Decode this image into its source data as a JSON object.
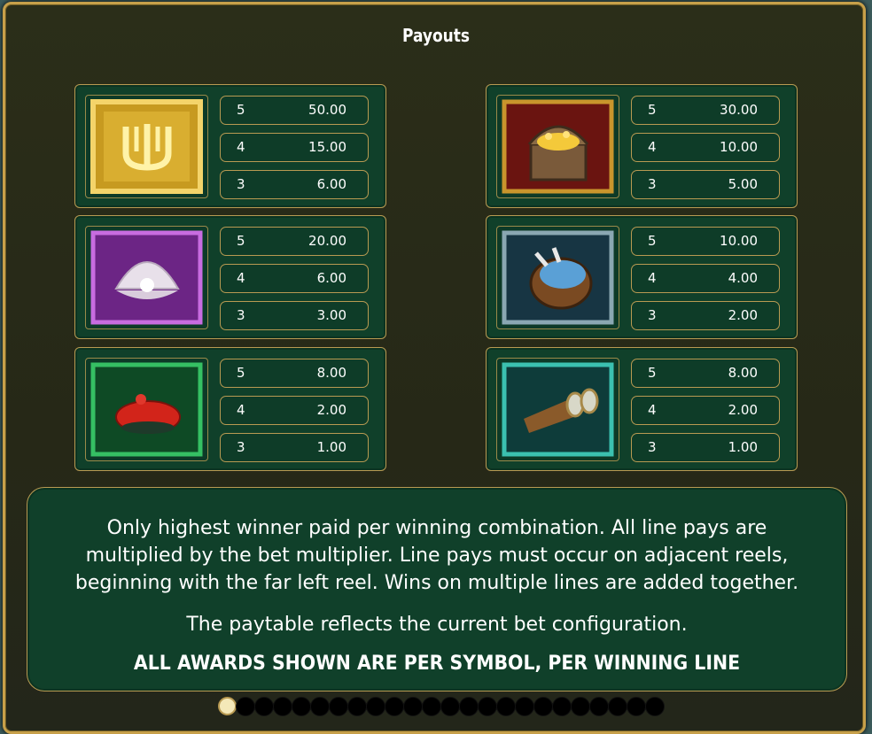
{
  "title": "Payouts",
  "symbols": [
    {
      "id": "trident",
      "rows": [
        [
          "5",
          "50.00"
        ],
        [
          "4",
          "15.00"
        ],
        [
          "3",
          "6.00"
        ]
      ]
    },
    {
      "id": "chest",
      "rows": [
        [
          "5",
          "30.00"
        ],
        [
          "4",
          "10.00"
        ],
        [
          "3",
          "5.00"
        ]
      ]
    },
    {
      "id": "pearl",
      "rows": [
        [
          "5",
          "20.00"
        ],
        [
          "4",
          "6.00"
        ],
        [
          "3",
          "3.00"
        ]
      ]
    },
    {
      "id": "bagpipe",
      "rows": [
        [
          "5",
          "10.00"
        ],
        [
          "4",
          "4.00"
        ],
        [
          "3",
          "2.00"
        ]
      ]
    },
    {
      "id": "beret",
      "rows": [
        [
          "5",
          "8.00"
        ],
        [
          "4",
          "2.00"
        ],
        [
          "3",
          "1.00"
        ]
      ]
    },
    {
      "id": "binoculars",
      "rows": [
        [
          "5",
          "8.00"
        ],
        [
          "4",
          "2.00"
        ],
        [
          "3",
          "1.00"
        ]
      ]
    }
  ],
  "info": {
    "line1": "Only highest winner paid per winning combination. All line pays are",
    "line2": "multiplied by the bet multiplier. Line pays must occur on adjacent reels,",
    "line3": "beginning with the far left reel. Wins on multiple lines are added together.",
    "line4": "The paytable reflects the current bet configuration.",
    "line5": "ALL AWARDS SHOWN ARE PER SYMBOL, PER WINNING LINE"
  },
  "pagination": {
    "current": 1,
    "total": 24
  }
}
